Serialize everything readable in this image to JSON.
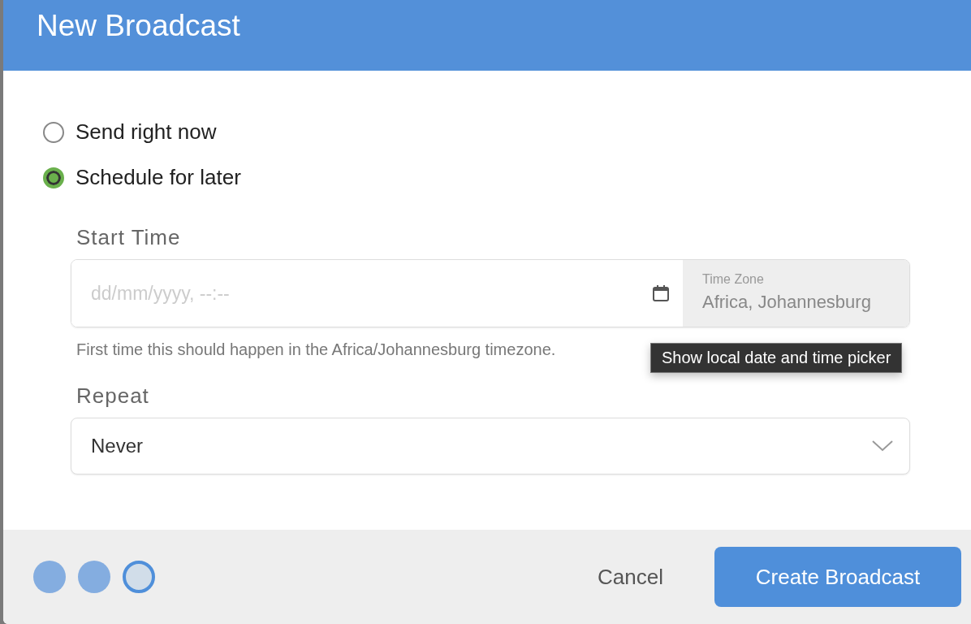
{
  "dialog": {
    "title": "New Broadcast"
  },
  "send_options": [
    {
      "label": "Send right now",
      "selected": false
    },
    {
      "label": "Schedule for later",
      "selected": true
    }
  ],
  "start_time": {
    "label": "Start Time",
    "placeholder": "dd/mm/yyyy, --:--",
    "time_zone_label": "Time Zone",
    "time_zone": "Africa, Johannesburg",
    "help": "First time this should happen in the Africa/Johannesburg timezone.",
    "tooltip": "Show local date and time picker"
  },
  "repeat": {
    "label": "Repeat",
    "value": "Never"
  },
  "steps": [
    {
      "selected": false
    },
    {
      "selected": false
    },
    {
      "selected": true
    }
  ],
  "buttons": {
    "cancel": "Cancel",
    "create": "Create Broadcast"
  }
}
